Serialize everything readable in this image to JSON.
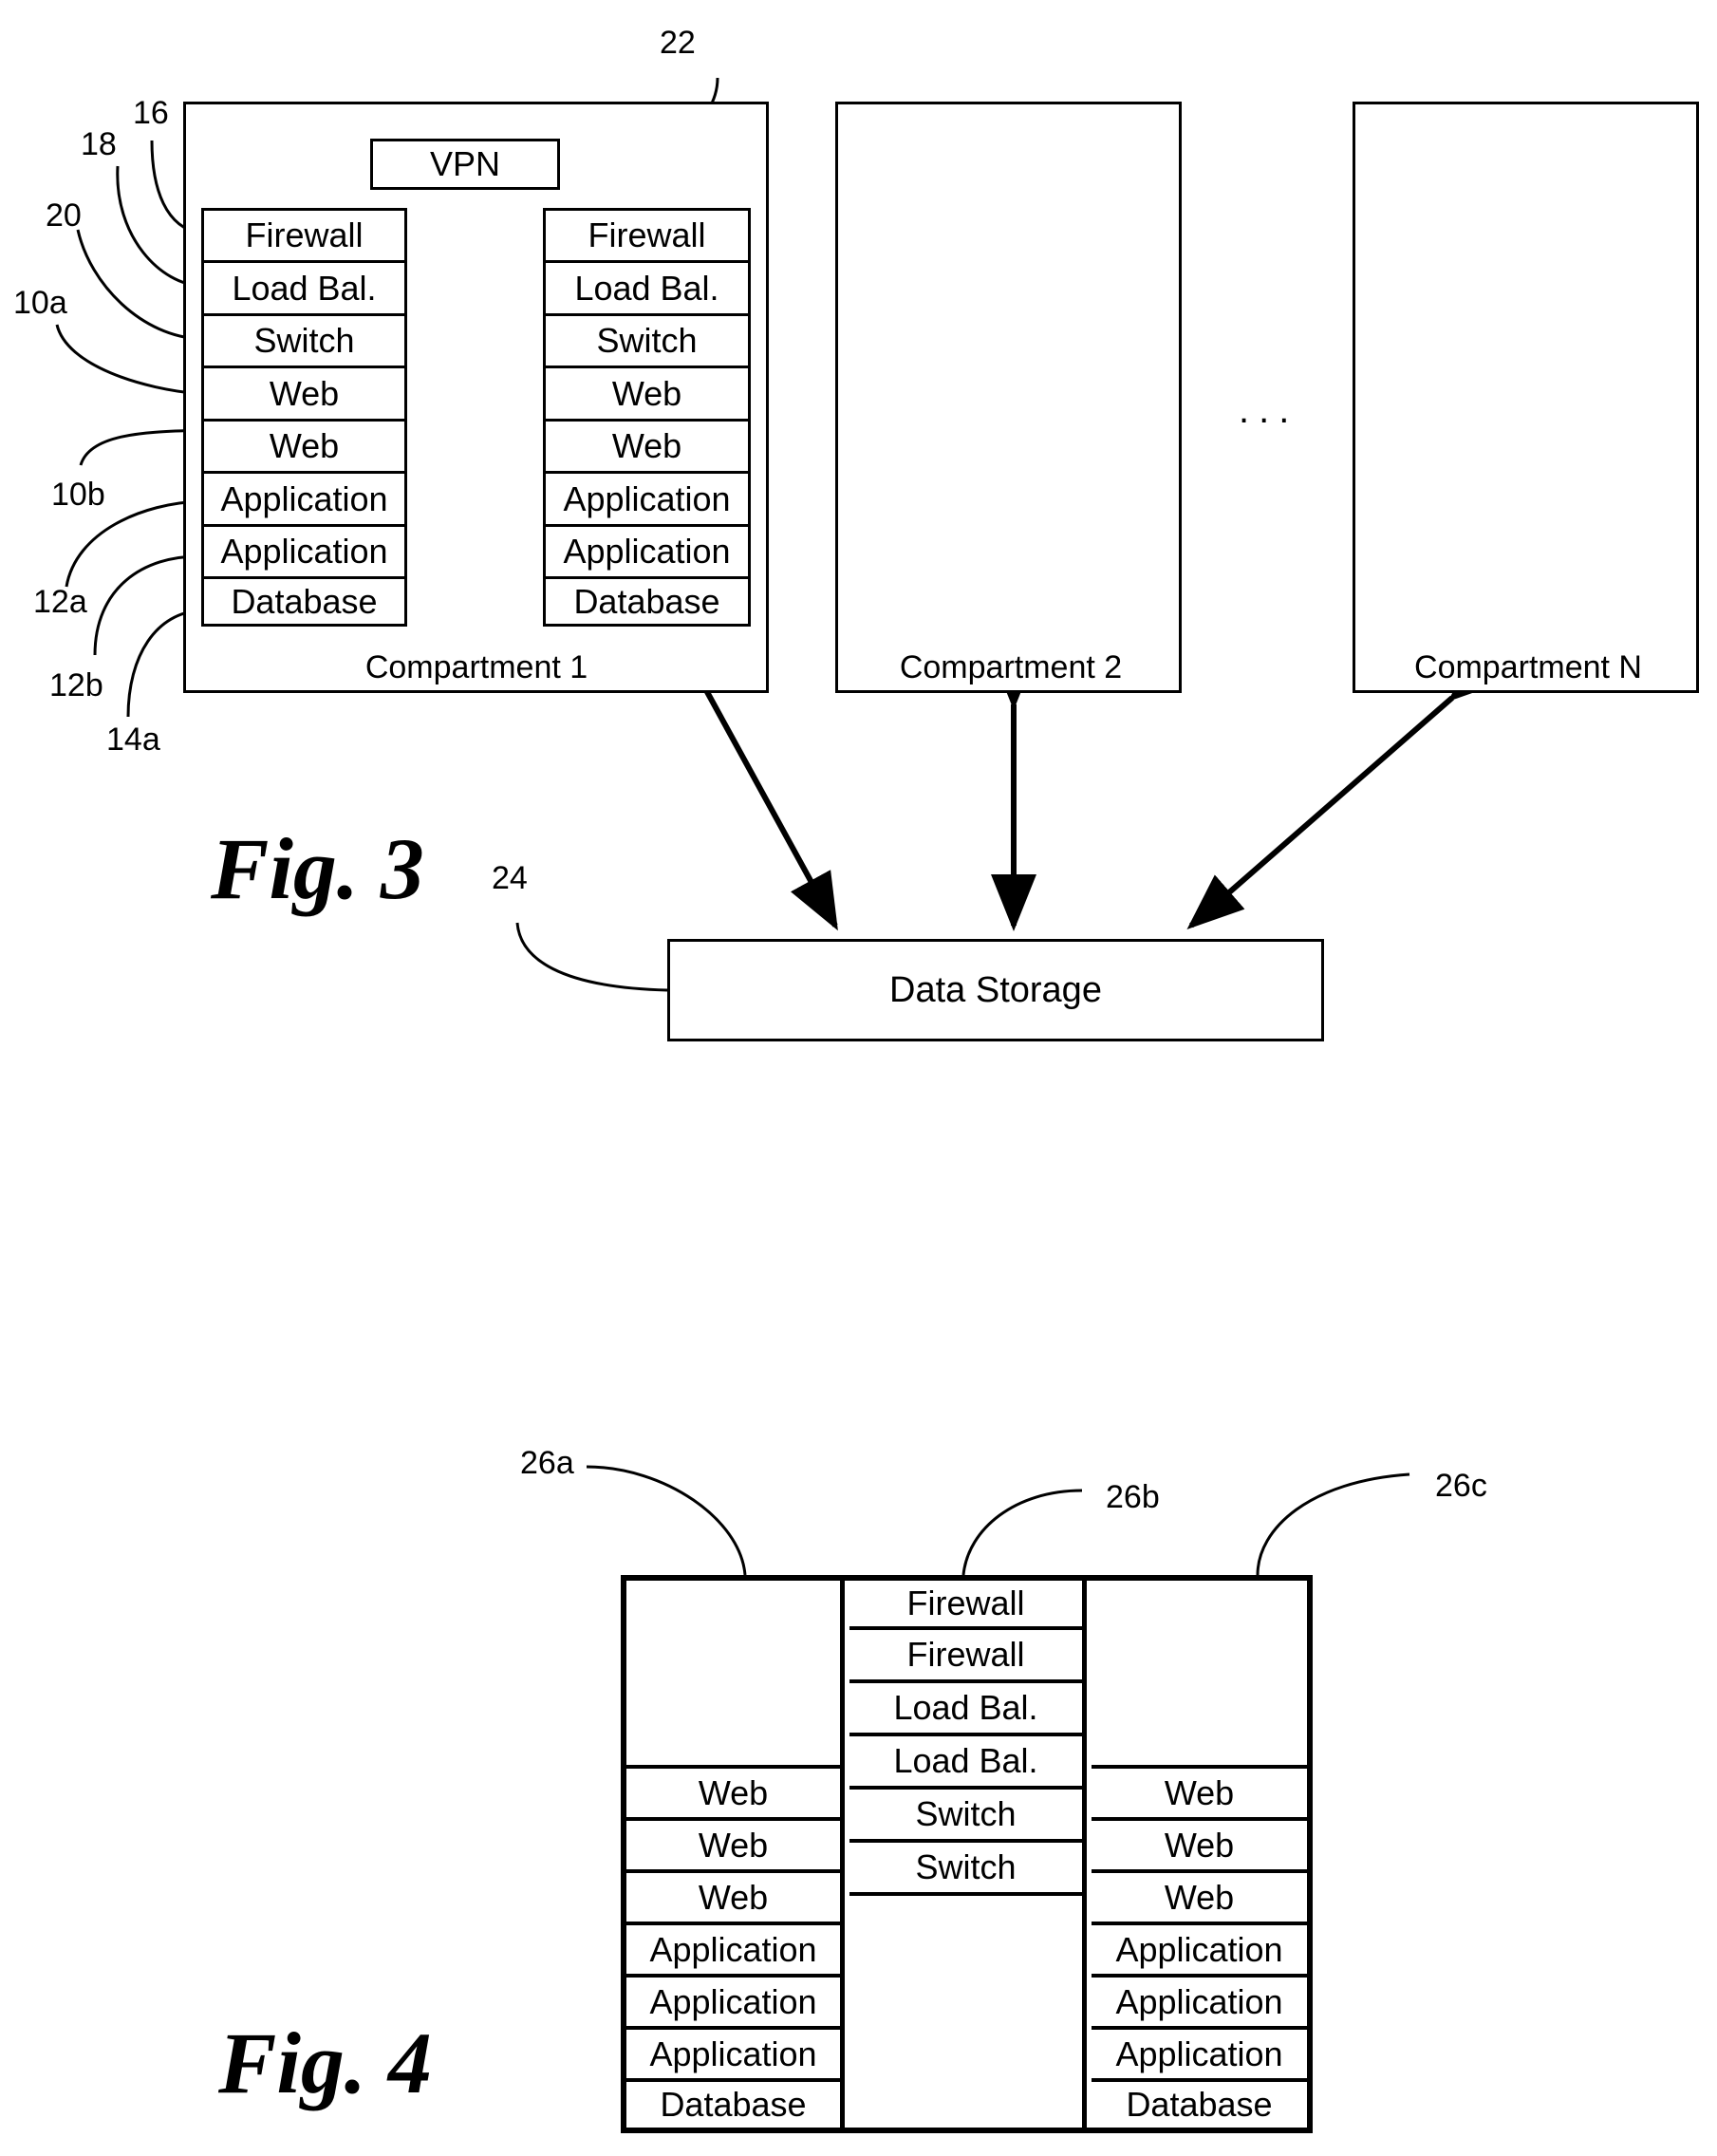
{
  "figure3": {
    "label": "Fig. 3",
    "vpn": "VPN",
    "ref_vpn": "22",
    "ref_data_storage": "24",
    "compartments": [
      {
        "caption": "Compartment 1"
      },
      {
        "caption": "Compartment 2"
      },
      {
        "caption": "Compartment N"
      }
    ],
    "ellipsis": "...",
    "left_stack": [
      "Firewall",
      "Load Bal.",
      "Switch",
      "Web",
      "Web",
      "Application",
      "Application",
      "Database"
    ],
    "right_stack": [
      "Firewall",
      "Load Bal.",
      "Switch",
      "Web",
      "Web",
      "Application",
      "Application",
      "Database"
    ],
    "left_refs": [
      "16",
      "18",
      "20",
      "10a",
      "10b",
      "12a",
      "12b",
      "14a"
    ],
    "data_storage": "Data Storage"
  },
  "figure4": {
    "label": "Fig. 4",
    "refs": [
      "26a",
      "26b",
      "26c"
    ],
    "column_a": [
      "Web",
      "Web",
      "Web",
      "Application",
      "Application",
      "Application",
      "Database"
    ],
    "column_b": [
      "Firewall",
      "Firewall",
      "Load Bal.",
      "Load Bal.",
      "Switch",
      "Switch"
    ],
    "column_c": [
      "Web",
      "Web",
      "Web",
      "Application",
      "Application",
      "Application",
      "Database"
    ]
  }
}
